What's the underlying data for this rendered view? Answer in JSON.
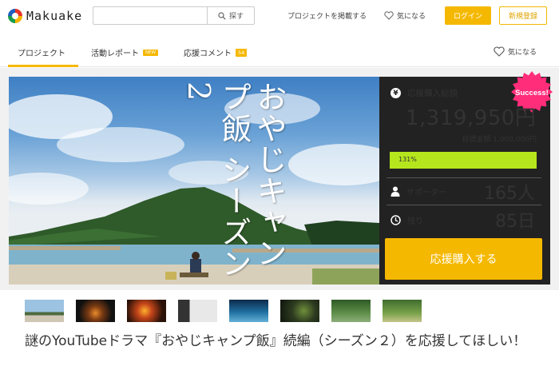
{
  "header": {
    "logo_text": "Makuake",
    "search_placeholder": "",
    "search_button": "探す",
    "post_project": "プロジェクトを掲載する",
    "favorite": "気になる",
    "login": "ログイン",
    "signup": "新規登録"
  },
  "tabs": [
    {
      "label": "プロジェクト",
      "active": true
    },
    {
      "label": "活動レポート",
      "badge": "NEW"
    },
    {
      "label": "応援コメント",
      "badge": "54"
    }
  ],
  "tab_favorite": "気になる",
  "hero": {
    "title_text": "おやじキャンプ飯 シーズン2"
  },
  "stats": {
    "success_badge": "Success!",
    "amount_label": "応援購入総額",
    "amount": "1,319,950円",
    "goal": "目標金額 1,000,000円",
    "progress_text": "131%",
    "progress_fraction": 1.0,
    "supporters_label": "サポーター",
    "supporters_value": "165人",
    "remaining_label": "残り",
    "remaining_value": "85日",
    "buy_button": "応援購入する"
  },
  "thumbnails": [
    {
      "name": "thumb-mountain"
    },
    {
      "name": "thumb-campfire-night"
    },
    {
      "name": "thumb-fire-cooking"
    },
    {
      "name": "thumb-screens"
    },
    {
      "name": "thumb-blue-sea"
    },
    {
      "name": "thumb-night-camp"
    },
    {
      "name": "thumb-forest-people"
    },
    {
      "name": "thumb-green-field"
    }
  ],
  "project_title": "謎のYouTubeドラマ『おやじキャンプ飯』続編（シーズン２）を応援してほしい！",
  "colors": {
    "accent": "#f5b800",
    "panel": "#222222",
    "progress": "#b5e61d",
    "success": "#ff2d7a"
  }
}
